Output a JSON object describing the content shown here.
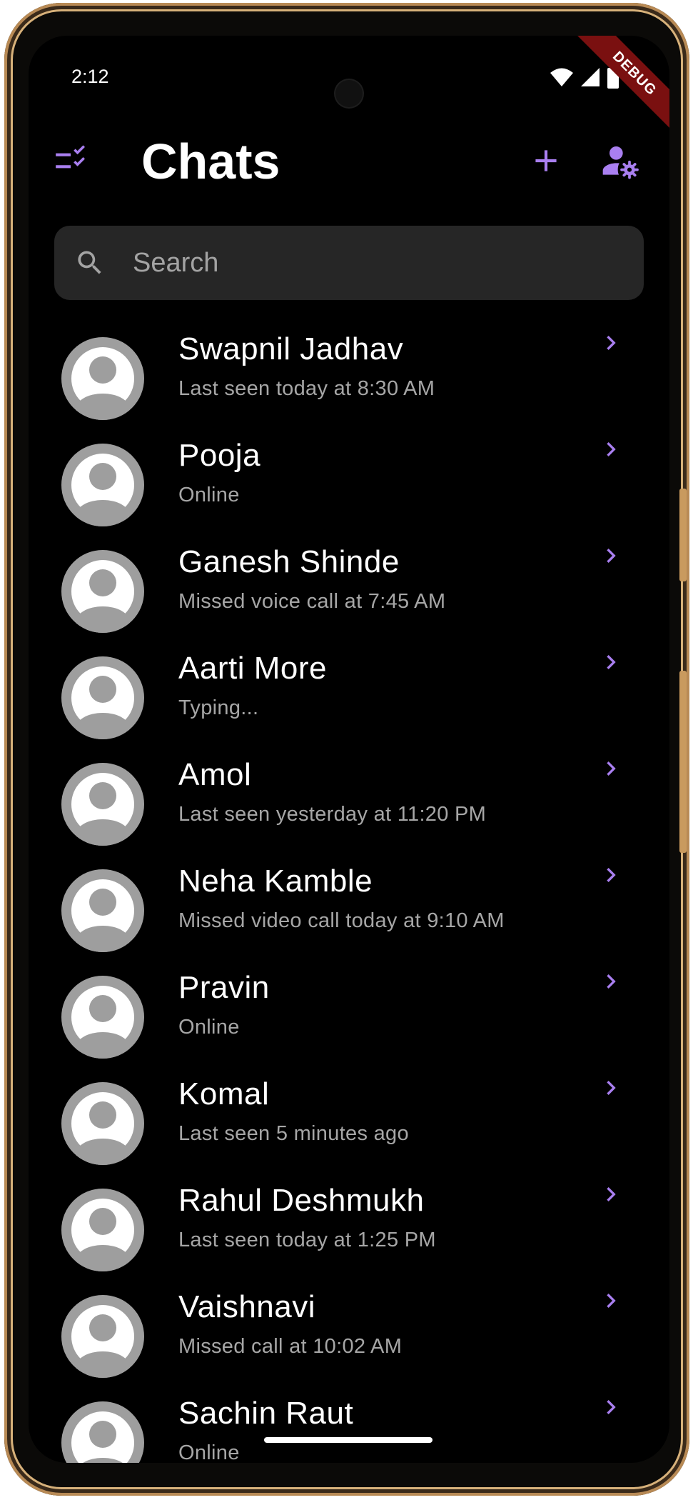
{
  "status_bar": {
    "time": "2:12",
    "debug_label": "DEBUG"
  },
  "app_bar": {
    "title": "Chats"
  },
  "search": {
    "placeholder": "Search"
  },
  "colors": {
    "accent": "#a97ff0",
    "background": "#000000",
    "avatar": "#9e9e9e"
  },
  "chats": [
    {
      "name": "Swapnil Jadhav",
      "status": "Last seen today at 8:30 AM"
    },
    {
      "name": "Pooja",
      "status": "Online"
    },
    {
      "name": "Ganesh Shinde",
      "status": "Missed voice call at 7:45 AM"
    },
    {
      "name": "Aarti More",
      "status": "Typing..."
    },
    {
      "name": "Amol",
      "status": "Last seen yesterday at 11:20 PM"
    },
    {
      "name": "Neha Kamble",
      "status": "Missed video call today at 9:10 AM"
    },
    {
      "name": "Pravin",
      "status": "Online"
    },
    {
      "name": "Komal",
      "status": "Last seen 5 minutes ago"
    },
    {
      "name": "Rahul Deshmukh",
      "status": "Last seen today at 1:25 PM"
    },
    {
      "name": "Vaishnavi",
      "status": "Missed call at 10:02 AM"
    },
    {
      "name": "Sachin Raut",
      "status": "Online"
    }
  ],
  "icons": {
    "leading": "checklist-icon",
    "add": "plus-icon",
    "settings": "manage-accounts-icon",
    "search": "search-icon",
    "row_trailing": "chevron-right-icon",
    "avatar": "person-icon"
  }
}
